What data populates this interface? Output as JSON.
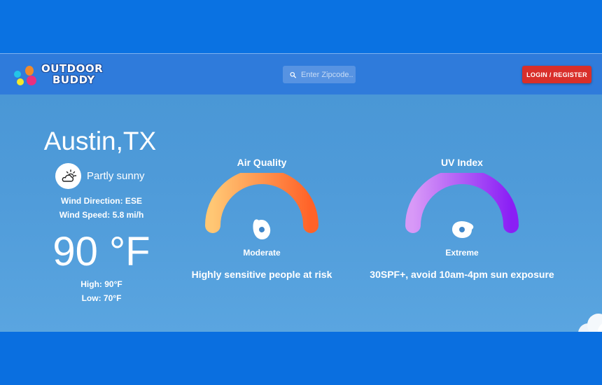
{
  "app": {
    "logo_line1": "OUTDOOR",
    "logo_line2": "BUDDY",
    "logo_dot_colors": [
      "#23c5e8",
      "#f08a2c",
      "#f5e82a",
      "#e8307f"
    ]
  },
  "search": {
    "placeholder": "Enter Zipcode..",
    "icon": "search-icon"
  },
  "nav": {
    "login_label": "LOGIN / REGISTER",
    "login_color": "#d92f2a"
  },
  "weather": {
    "city": "Austin,TX",
    "condition": "Partly sunny",
    "condition_icon": "partly-sunny-icon",
    "wind_direction": "Wind Direction: ESE",
    "wind_speed": "Wind Speed: 5.8 mi/h",
    "temperature": "90 °F",
    "high": "High: 90°F",
    "low": "Low: 70°F"
  },
  "air_quality": {
    "title": "Air Quality",
    "level": "Moderate",
    "description": "Highly sensitive people at risk",
    "gradient": [
      "#ffc774",
      "#ff6228"
    ],
    "needle_fraction": 0.4
  },
  "uv_index": {
    "title": "UV Index",
    "level": "Extreme",
    "description": "30SPF+, avoid 10am-4pm sun exposure",
    "gradient": [
      "#d899f7",
      "#8a1ff5"
    ],
    "needle_fraction": 1.0
  }
}
